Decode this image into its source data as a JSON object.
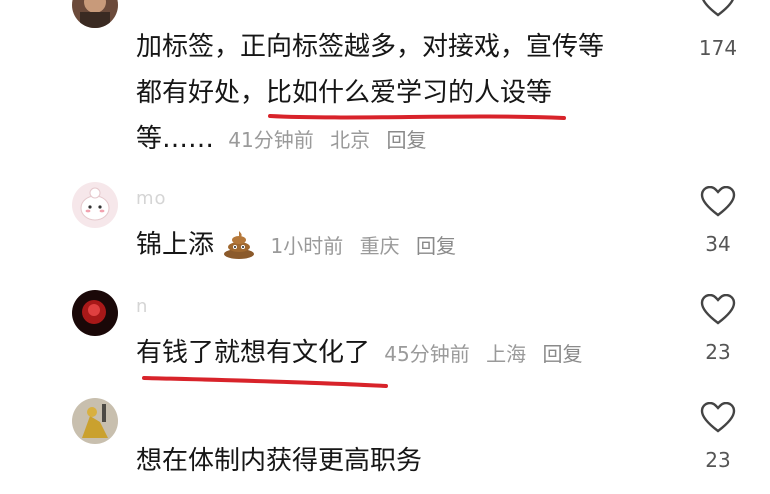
{
  "comments": [
    {
      "username": "",
      "lines": [
        "加标签，正向标签越多，对接戏，宣传等",
        "都有好处，比如什么爱学习的人设等"
      ],
      "last_line_text": "等……",
      "time": "41分钟前",
      "location": "北京",
      "reply": "回复",
      "likes": "174"
    },
    {
      "username": "mo",
      "text": "锦上添",
      "emoji": "poop-emoji",
      "time": "1小时前",
      "location": "重庆",
      "reply": "回复",
      "likes": "34"
    },
    {
      "username": "n",
      "text": "有钱了就想有文化了",
      "time": "45分钟前",
      "location": "上海",
      "reply": "回复",
      "likes": "23"
    },
    {
      "username": "",
      "text": "想在体制内获得更高职务",
      "likes": "23"
    }
  ],
  "colors": {
    "annotation_red": "#d8232a",
    "meta_gray": "#9a9a9a",
    "icon_gray": "#444444"
  }
}
